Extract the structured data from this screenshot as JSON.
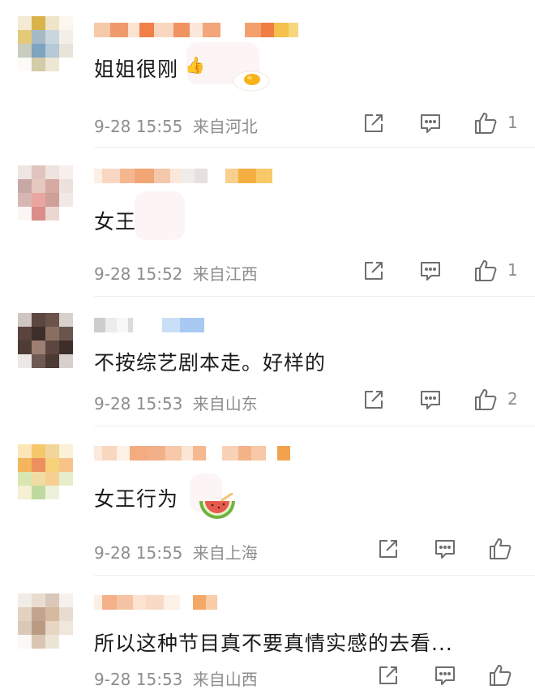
{
  "comments": [
    {
      "text": "姐姐很刚",
      "emoji": "thumbs-up-and-egg-sticker",
      "date": "9-28",
      "time": "15:55",
      "location": "来自河北",
      "likes": "1"
    },
    {
      "text": "女王",
      "emoji": "",
      "date": "9-28",
      "time": "15:52",
      "location": "来自江西",
      "likes": "1"
    },
    {
      "text": "不按综艺剧本走。好样的",
      "emoji": "",
      "date": "9-28",
      "time": "15:53",
      "location": "来自山东",
      "likes": "2"
    },
    {
      "text": "女王行为",
      "emoji": "watermelon-sticker",
      "date": "9-28",
      "time": "15:55",
      "location": "来自上海",
      "likes": ""
    },
    {
      "text": "所以这种节目真不要真情实感的去看...",
      "emoji": "",
      "date": "9-28",
      "time": "15:53",
      "location": "来自山西",
      "likes": ""
    }
  ],
  "icons": {
    "share": "share-icon",
    "comment": "comment-icon",
    "like": "thumbs-up-icon"
  },
  "colors": {
    "meta_text": "#8d8d8d",
    "icon_stroke": "#6e6e6e"
  }
}
